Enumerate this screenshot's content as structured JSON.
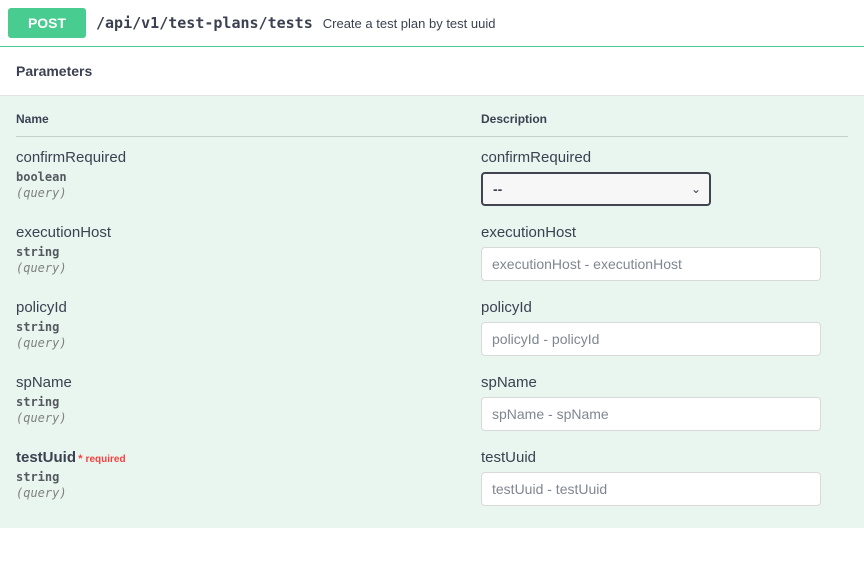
{
  "endpoint": {
    "method": "POST",
    "path": "/api/v1/test-plans/tests",
    "summary": "Create a test plan by test uuid"
  },
  "section": {
    "parameters": "Parameters"
  },
  "table": {
    "nameHeader": "Name",
    "descHeader": "Description"
  },
  "labels": {
    "requiredStar": "*",
    "required": "required"
  },
  "selectDefault": "--",
  "params": [
    {
      "name": "confirmRequired",
      "type": "boolean",
      "in": "(query)",
      "required": false,
      "desc": "confirmRequired",
      "control": "select"
    },
    {
      "name": "executionHost",
      "type": "string",
      "in": "(query)",
      "required": false,
      "desc": "executionHost",
      "control": "input",
      "placeholder": "executionHost - executionHost"
    },
    {
      "name": "policyId",
      "type": "string",
      "in": "(query)",
      "required": false,
      "desc": "policyId",
      "control": "input",
      "placeholder": "policyId - policyId"
    },
    {
      "name": "spName",
      "type": "string",
      "in": "(query)",
      "required": false,
      "desc": "spName",
      "control": "input",
      "placeholder": "spName - spName"
    },
    {
      "name": "testUuid",
      "type": "string",
      "in": "(query)",
      "required": true,
      "desc": "testUuid",
      "control": "input",
      "placeholder": "testUuid - testUuid"
    }
  ]
}
